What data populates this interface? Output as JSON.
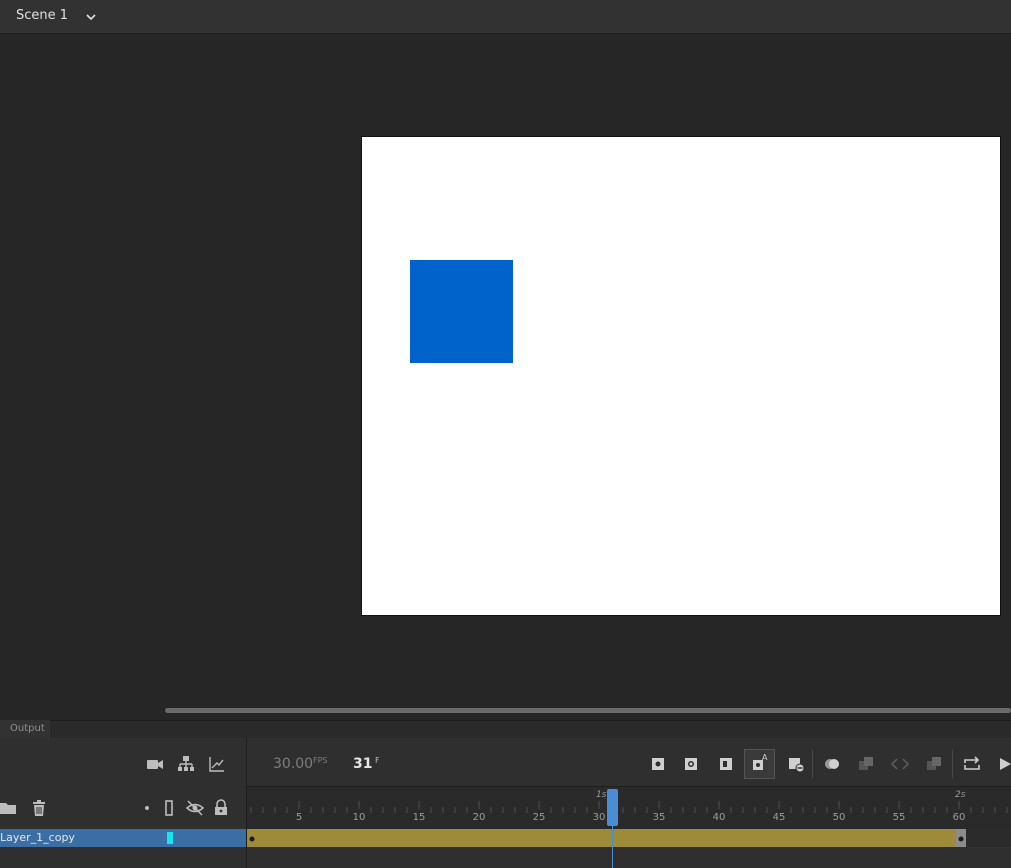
{
  "scene": {
    "label": "Scene 1",
    "chevron_icon": "chevron-down-icon"
  },
  "stage": {
    "background": "#ffffff",
    "shape_color": "#0063cc"
  },
  "output_panel": {
    "tab_label": "Output"
  },
  "timeline": {
    "fps_value": "30.00",
    "fps_unit": "FPS",
    "current_frame": "31",
    "frame_unit": "F",
    "ruler_ticks": [
      "5",
      "10",
      "15",
      "20",
      "25",
      "30",
      "35",
      "40",
      "45",
      "50",
      "55",
      "60"
    ],
    "second_markers": [
      "1s",
      "2s"
    ],
    "layer": {
      "name": "Layer_1_copy",
      "color": "#15e7f2"
    },
    "tween_color": "#9d8b3a",
    "playhead_color": "#4a8dd4",
    "left_toolbar_icons": [
      "camera-icon",
      "layer-parenting-icon",
      "graph-icon"
    ],
    "layer_tools_icons": [
      "new-folder-icon",
      "delete-icon"
    ],
    "layer_header_icons": [
      "dot-icon",
      "outline-icon",
      "visibility-icon",
      "lock-icon"
    ],
    "playback_icons": [
      "insert-keyframe-icon",
      "insert-blank-keyframe-icon",
      "insert-frame-icon",
      "auto-keyframe-icon",
      "remove-frame-icon",
      "onion-skin-icon",
      "edit-multiple-frames-icon",
      "previous-frame-icon",
      "next-frame-icon",
      "loop-icon",
      "play-icon"
    ]
  }
}
